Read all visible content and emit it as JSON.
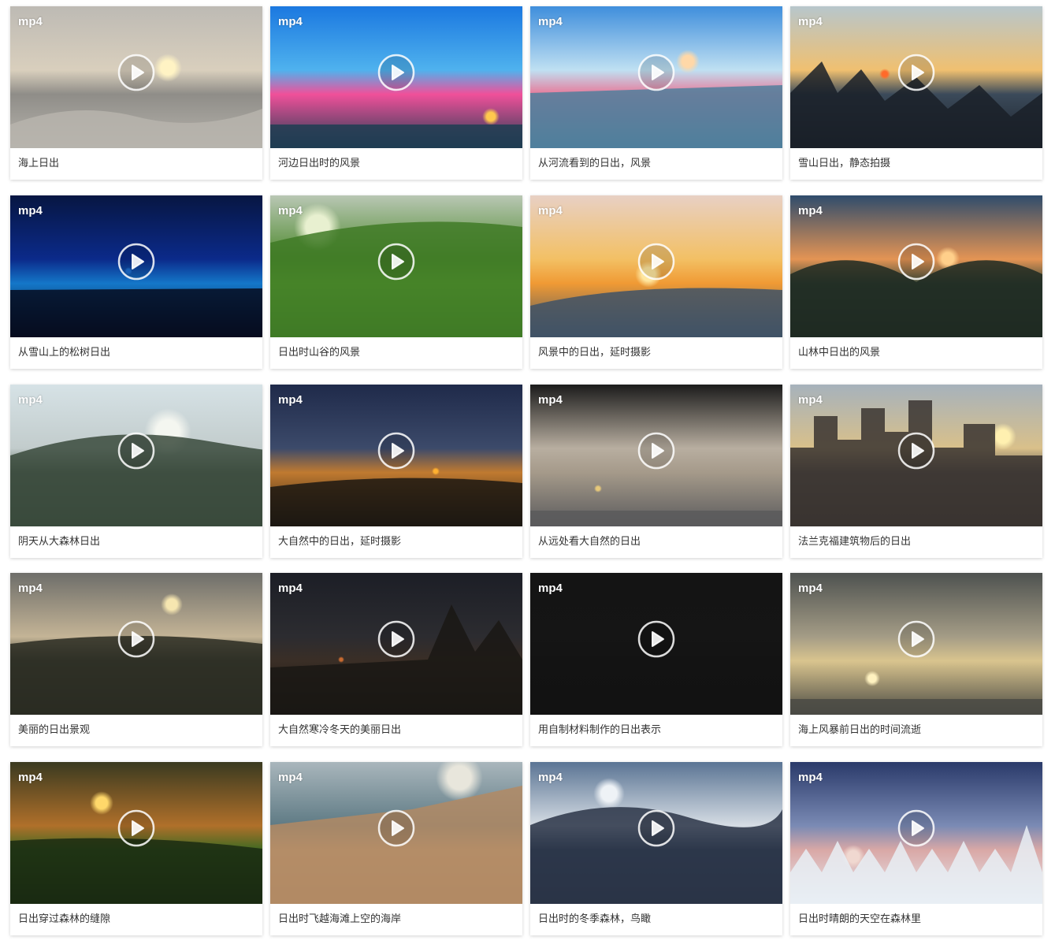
{
  "play_icon": "play-circle-icon",
  "items": [
    {
      "format": "mp4",
      "title": "海上日出",
      "colors": [
        "#bdbab4",
        "#d9cfbd",
        "#8f8d88",
        "#b7b4ad"
      ],
      "sun": "#fff3c4"
    },
    {
      "format": "mp4",
      "title": "河边日出时的风景",
      "colors": [
        "#1b78e0",
        "#4fb2ee",
        "#f0509a",
        "#1f3d52"
      ],
      "sun": "#ffc84d"
    },
    {
      "format": "mp4",
      "title": "从河流看到的日出，风景",
      "colors": [
        "#3f8edc",
        "#bfe0f2",
        "#e77a9a",
        "#4f7f9c"
      ],
      "sun": "#ffd8a8"
    },
    {
      "format": "mp4",
      "title": "雪山日出，静态拍摄",
      "colors": [
        "#b7c6cc",
        "#f0c070",
        "#3b4a5a",
        "#1a2028"
      ],
      "sun": "#ff6a2a"
    },
    {
      "format": "mp4",
      "title": "从雪山上的松树日出",
      "colors": [
        "#071642",
        "#0b2a8a",
        "#1477c9",
        "#060c1e"
      ],
      "sun": "#1f6fd0"
    },
    {
      "format": "mp4",
      "title": "日出时山谷的风景",
      "colors": [
        "#b9c7b4",
        "#4e8a2e",
        "#6fb83a",
        "#3f7a26"
      ],
      "sun": "#e8f0d0"
    },
    {
      "format": "mp4",
      "title": "风景中的日出，延时摄影",
      "colors": [
        "#e8d0c4",
        "#f3c064",
        "#f09a34",
        "#3f5266"
      ],
      "sun": "#ffe7a0"
    },
    {
      "format": "mp4",
      "title": "山林中日出的风景",
      "colors": [
        "#2f4c6c",
        "#e49454",
        "#3d4c3c",
        "#1f2a22"
      ],
      "sun": "#ffcf8a"
    },
    {
      "format": "mp4",
      "title": "阴天从大森林日出",
      "colors": [
        "#d6e2e6",
        "#c2cccc",
        "#5c6a5e",
        "#3a4a3c"
      ],
      "sun": "#f4f6f0"
    },
    {
      "format": "mp4",
      "title": "大自然中的日出，延时摄影",
      "colors": [
        "#1f2a4a",
        "#3c4a6a",
        "#c07a30",
        "#1c1812"
      ],
      "sun": "#ffb030"
    },
    {
      "format": "mp4",
      "title": "从远处看大自然的日出",
      "colors": [
        "#1b1b1b",
        "#b8aea0",
        "#a59a8a",
        "#5a5a5c"
      ],
      "sun": "#e6c87a"
    },
    {
      "format": "mp4",
      "title": "法兰克福建筑物后的日出",
      "colors": [
        "#a6b2bc",
        "#d9c08a",
        "#5c5650",
        "#3a3430"
      ],
      "sun": "#fff0b0"
    },
    {
      "format": "mp4",
      "title": "美丽的日出景观",
      "colors": [
        "#6e6e6a",
        "#c4b496",
        "#4a4c3e",
        "#2a2c22"
      ],
      "sun": "#f6e6b0"
    },
    {
      "format": "mp4",
      "title": "大自然寒冷冬天的美丽日出",
      "colors": [
        "#1c1e26",
        "#2c2c30",
        "#3a2e26",
        "#1a1814"
      ],
      "sun": "#c86a30"
    },
    {
      "format": "mp4",
      "title": "用自制材料制作的日出表示",
      "colors": [
        "#141414",
        "#151515",
        "#131313",
        "#121212"
      ],
      "sun": "#141414"
    },
    {
      "format": "mp4",
      "title": "海上风暴前日出的时间流逝",
      "colors": [
        "#4e5250",
        "#a49c86",
        "#d9c48e",
        "#4a4a44"
      ],
      "sun": "#fff2c0"
    },
    {
      "format": "mp4",
      "title": "日出穿过森林的缝隙",
      "colors": [
        "#3a3a20",
        "#b0702a",
        "#3f6a22",
        "#1a2a12"
      ],
      "sun": "#ffd86a"
    },
    {
      "format": "mp4",
      "title": "日出时飞越海滩上空的海岸",
      "colors": [
        "#a9b6bc",
        "#5e7a84",
        "#c4a07a",
        "#b18a64"
      ],
      "sun": "#e8e6dc"
    },
    {
      "format": "mp4",
      "title": "日出时的冬季森林，鸟瞰",
      "colors": [
        "#5a7494",
        "#d6dde4",
        "#3a4c62",
        "#2a3446"
      ],
      "sun": "#eef2f6"
    },
    {
      "format": "mp4",
      "title": "日出时晴朗的天空在森林里",
      "colors": [
        "#2a3a6a",
        "#7a8ab4",
        "#d9a8a6",
        "#e8eef4"
      ],
      "sun": "#f0d8d0"
    }
  ]
}
